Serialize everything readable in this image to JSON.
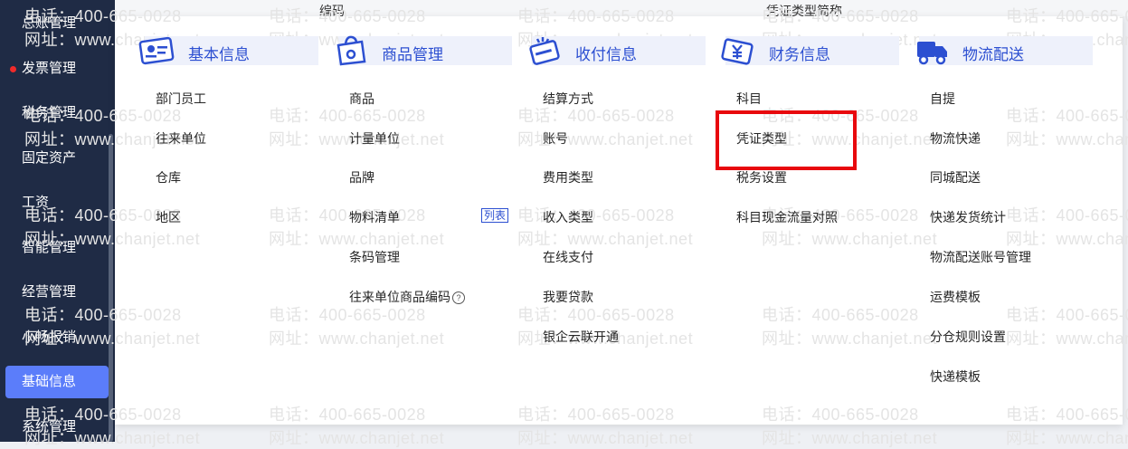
{
  "sidebar": {
    "items": [
      {
        "label": "总账管理"
      },
      {
        "label": "发票管理",
        "badge": "red-dot"
      },
      {
        "label": "税务管理"
      },
      {
        "label": "固定资产"
      },
      {
        "label": "工资"
      },
      {
        "label": "智能管理"
      },
      {
        "label": "经营管理"
      },
      {
        "label": "小畅报销"
      },
      {
        "label": "基础信息",
        "active": true
      },
      {
        "label": "系统管理"
      }
    ]
  },
  "background_headers": {
    "code": "编码",
    "voucher_type_short": "凭证类型简称"
  },
  "watermark": {
    "phone": "电话：400-665-0028",
    "site": "网址：www.chanjet.net"
  },
  "columns": [
    {
      "title": "基本信息",
      "icon": "id-card-icon",
      "items": [
        "部门员工",
        "往来单位",
        "仓库",
        "地区"
      ]
    },
    {
      "title": "商品管理",
      "icon": "goods-bag-icon",
      "items": [
        "商品",
        "计量单位",
        "品牌",
        "物料清单",
        "条码管理",
        "往来单位商品编码"
      ],
      "tag": "列表",
      "help_icon": "question-circle-icon"
    },
    {
      "title": "收付信息",
      "icon": "payment-card-icon",
      "items": [
        "结算方式",
        "账号",
        "费用类型",
        "收入类型",
        "在线支付",
        "我要贷款",
        "银企云联开通"
      ]
    },
    {
      "title": "财务信息",
      "icon": "finance-yen-icon",
      "items": [
        "科目",
        "凭证类型",
        "税务设置",
        "科目现金流量对照"
      ]
    },
    {
      "title": "物流配送",
      "icon": "truck-icon",
      "items": [
        "自提",
        "物流快递",
        "同城配送",
        "快递发货统计",
        "物流配送账号管理",
        "运费模板",
        "分仓规则设置",
        "快递模板"
      ]
    }
  ],
  "highlight": {
    "target": "凭证类型",
    "color": "#e8080d"
  },
  "colors": {
    "accent": "#2c4fd1",
    "sidebar_bg": "#1f2b45",
    "active_bg": "#5b7dfa"
  }
}
